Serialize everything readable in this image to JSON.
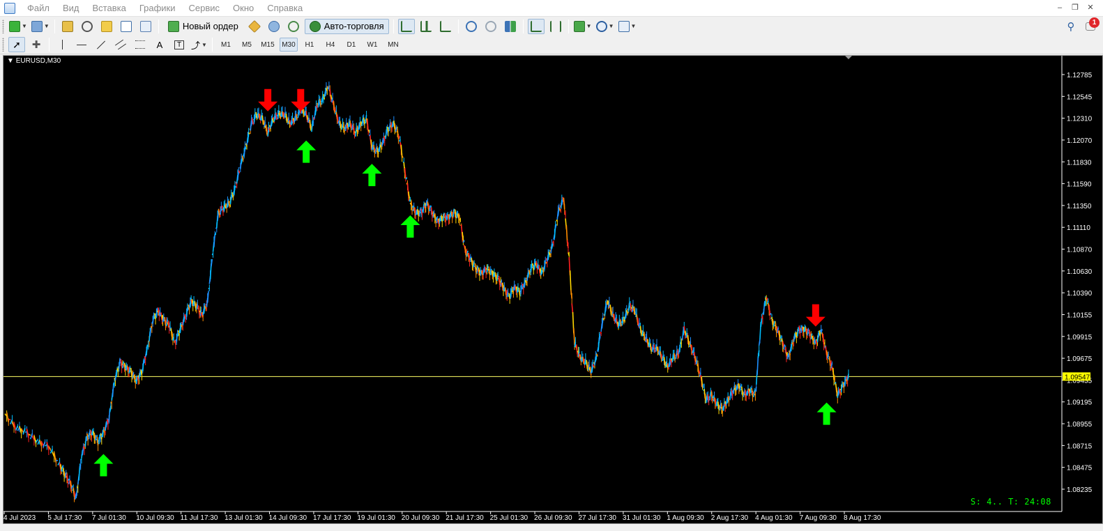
{
  "menu": {
    "items": [
      "Файл",
      "Вид",
      "Вставка",
      "Графики",
      "Сервис",
      "Окно",
      "Справка"
    ]
  },
  "toolbar1": {
    "new_order_label": "Новый ордер",
    "auto_trading_label": "Авто-торговля",
    "notification_count": "1"
  },
  "toolbar2": {
    "timeframes": [
      "M1",
      "M5",
      "M15",
      "M30",
      "H1",
      "H4",
      "D1",
      "W1",
      "MN"
    ],
    "active_timeframe": "M30",
    "text_tool_label": "A"
  },
  "chart": {
    "symbol_label": "EURUSD,M30",
    "current_price": "1.09547",
    "status_text": "S: 4.. T: 24:08",
    "background": "#000000",
    "price_line_color": "#ffff66"
  },
  "chart_data": {
    "type": "line",
    "symbol": "EURUSD",
    "timeframe": "M30",
    "y_tick_labels": [
      "1.12785",
      "1.12545",
      "1.12310",
      "1.12070",
      "1.11830",
      "1.11590",
      "1.11350",
      "1.11110",
      "1.10870",
      "1.10630",
      "1.10390",
      "1.10155",
      "1.09915",
      "1.09675",
      "1.09435",
      "1.09195",
      "1.08955",
      "1.08715",
      "1.08475",
      "1.08235"
    ],
    "x_tick_labels": [
      "4 Jul 2023",
      "5 Jul 17:30",
      "7 Jul 01:30",
      "10 Jul 09:30",
      "11 Jul 17:30",
      "13 Jul 01:30",
      "14 Jul 09:30",
      "17 Jul 17:30",
      "19 Jul 01:30",
      "20 Jul 09:30",
      "21 Jul 17:30",
      "25 Jul 01:30",
      "26 Jul 09:30",
      "27 Jul 17:30",
      "31 Jul 01:30",
      "1 Aug 09:30",
      "2 Aug 17:30",
      "4 Aug 01:30",
      "7 Aug 09:30",
      "8 Aug 17:30"
    ],
    "ylim": [
      1.0815,
      1.129
    ],
    "current_price": 1.09547,
    "series": [
      {
        "values": [
          [
            0,
            1.0915
          ],
          [
            2,
            1.09
          ],
          [
            4,
            1.0895
          ],
          [
            6,
            1.0885
          ],
          [
            8,
            1.088
          ],
          [
            10,
            1.086
          ],
          [
            11,
            1.085
          ],
          [
            12,
            1.084
          ],
          [
            13,
            1.0825
          ],
          [
            14,
            1.087
          ],
          [
            15,
            1.089
          ],
          [
            16,
            1.0895
          ],
          [
            17,
            1.0885
          ],
          [
            18,
            1.0895
          ],
          [
            19,
            1.091
          ],
          [
            20,
            1.095
          ],
          [
            21,
            1.097
          ],
          [
            22,
            1.0965
          ],
          [
            23,
            1.096
          ],
          [
            24,
            1.095
          ],
          [
            25,
            1.096
          ],
          [
            26,
            1.0985
          ],
          [
            27,
            1.1015
          ],
          [
            28,
            1.1025
          ],
          [
            29,
            1.1015
          ],
          [
            30,
            1.101
          ],
          [
            31,
            1.099
          ],
          [
            32,
            1.1005
          ],
          [
            33,
            1.102
          ],
          [
            34,
            1.1035
          ],
          [
            35,
            1.103
          ],
          [
            36,
            1.102
          ],
          [
            37,
            1.1035
          ],
          [
            38,
            1.109
          ],
          [
            39,
            1.113
          ],
          [
            40,
            1.1135
          ],
          [
            41,
            1.114
          ],
          [
            42,
            1.1155
          ],
          [
            43,
            1.118
          ],
          [
            44,
            1.12
          ],
          [
            45,
            1.1225
          ],
          [
            46,
            1.1235
          ],
          [
            47,
            1.123
          ],
          [
            48,
            1.1215
          ],
          [
            49,
            1.123
          ],
          [
            50,
            1.1235
          ],
          [
            51,
            1.1235
          ],
          [
            52,
            1.1225
          ],
          [
            53,
            1.123
          ],
          [
            54,
            1.124
          ],
          [
            55,
            1.1235
          ],
          [
            56,
            1.122
          ],
          [
            57,
            1.1245
          ],
          [
            58,
            1.125
          ],
          [
            59,
            1.1265
          ],
          [
            60,
            1.1245
          ],
          [
            61,
            1.1225
          ],
          [
            62,
            1.122
          ],
          [
            63,
            1.1225
          ],
          [
            64,
            1.1215
          ],
          [
            65,
            1.1225
          ],
          [
            66,
            1.123
          ],
          [
            67,
            1.12
          ],
          [
            68,
            1.1195
          ],
          [
            69,
            1.1205
          ],
          [
            70,
            1.122
          ],
          [
            71,
            1.1225
          ],
          [
            72,
            1.121
          ],
          [
            73,
            1.1175
          ],
          [
            74,
            1.114
          ],
          [
            75,
            1.113
          ],
          [
            76,
            1.113
          ],
          [
            77,
            1.114
          ],
          [
            78,
            1.113
          ],
          [
            79,
            1.112
          ],
          [
            80,
            1.1125
          ],
          [
            81,
            1.1125
          ],
          [
            82,
            1.113
          ],
          [
            83,
            1.1125
          ],
          [
            84,
            1.109
          ],
          [
            85,
            1.108
          ],
          [
            86,
            1.107
          ],
          [
            87,
            1.1065
          ],
          [
            88,
            1.107
          ],
          [
            89,
            1.1065
          ],
          [
            90,
            1.106
          ],
          [
            91,
            1.105
          ],
          [
            92,
            1.104
          ],
          [
            93,
            1.105
          ],
          [
            94,
            1.1045
          ],
          [
            95,
            1.1055
          ],
          [
            96,
            1.107
          ],
          [
            97,
            1.1075
          ],
          [
            98,
            1.1065
          ],
          [
            99,
            1.108
          ],
          [
            100,
            1.1095
          ],
          [
            101,
            1.113
          ],
          [
            102,
            1.1145
          ],
          [
            103,
            1.108
          ],
          [
            104,
            1.099
          ],
          [
            105,
            1.0975
          ],
          [
            106,
            1.097
          ],
          [
            107,
            1.096
          ],
          [
            108,
            1.0975
          ],
          [
            109,
            1.101
          ],
          [
            110,
            1.1035
          ],
          [
            111,
            1.102
          ],
          [
            112,
            1.101
          ],
          [
            113,
            1.1015
          ],
          [
            114,
            1.103
          ],
          [
            115,
            1.1025
          ],
          [
            116,
            1.1005
          ],
          [
            117,
            1.0995
          ],
          [
            118,
            1.0985
          ],
          [
            119,
            1.0985
          ],
          [
            120,
            1.0975
          ],
          [
            121,
            1.0965
          ],
          [
            122,
            1.0975
          ],
          [
            123,
            1.098
          ],
          [
            124,
            1.1005
          ],
          [
            125,
            1.099
          ],
          [
            126,
            1.0975
          ],
          [
            127,
            1.0955
          ],
          [
            128,
            1.093
          ],
          [
            129,
            1.0935
          ],
          [
            130,
            1.0925
          ],
          [
            131,
            1.092
          ],
          [
            132,
            1.093
          ],
          [
            133,
            1.094
          ],
          [
            134,
            1.0945
          ],
          [
            135,
            1.0935
          ],
          [
            136,
            1.094
          ],
          [
            137,
            1.0935
          ],
          [
            138,
            1.101
          ],
          [
            139,
            1.104
          ],
          [
            140,
            1.1015
          ],
          [
            141,
            1.1005
          ],
          [
            142,
            1.099
          ],
          [
            143,
            1.0975
          ],
          [
            144,
            1.0995
          ],
          [
            145,
            1.1005
          ],
          [
            146,
            1.1005
          ],
          [
            147,
            1.1
          ],
          [
            148,
            1.099
          ],
          [
            149,
            1.1005
          ],
          [
            150,
            1.098
          ],
          [
            151,
            1.0965
          ],
          [
            152,
            1.0935
          ],
          [
            153,
            1.0945
          ],
          [
            154,
            1.0955
          ]
        ]
      }
    ],
    "signals": [
      {
        "x": 18,
        "y": 1.086,
        "type": "buy",
        "color": "#00ff00"
      },
      {
        "x": 48,
        "y": 1.125,
        "type": "sell",
        "color": "#ff0000"
      },
      {
        "x": 54,
        "y": 1.125,
        "type": "sell",
        "color": "#ff0000"
      },
      {
        "x": 55,
        "y": 1.1195,
        "type": "buy",
        "color": "#00ff00"
      },
      {
        "x": 67,
        "y": 1.117,
        "type": "buy",
        "color": "#00ff00"
      },
      {
        "x": 74,
        "y": 1.1115,
        "type": "buy",
        "color": "#00ff00"
      },
      {
        "x": 148,
        "y": 1.102,
        "type": "sell",
        "color": "#ff0000"
      },
      {
        "x": 150,
        "y": 1.0915,
        "type": "buy",
        "color": "#00ff00"
      }
    ]
  }
}
